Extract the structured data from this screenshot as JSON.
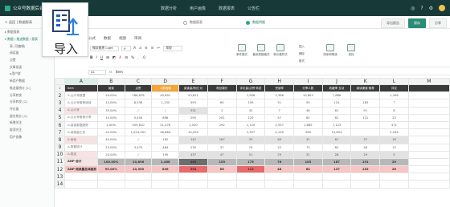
{
  "app": {
    "title": "公众号数据后台",
    "nav": [
      "数据分析",
      "用户画像",
      "数据报表",
      "公告栏"
    ]
  },
  "sidebar": {
    "header": "< 返回 | 数据报表",
    "items": [
      {
        "label": "▸ 数据报表",
        "indent": false,
        "active": false
      },
      {
        "label": "▾ 数据 / 推送数据 / 报表",
        "indent": false,
        "active": true
      },
      {
        "label": "表 (可编辑)",
        "indent": true,
        "active": false
      },
      {
        "label": "阅读量",
        "indent": true,
        "active": false
      },
      {
        "label": "点赞",
        "indent": true,
        "active": false
      },
      {
        "label": "文章阅读",
        "indent": true,
        "active": false
      },
      {
        "label": "a用户群",
        "indent": true,
        "active": false
      },
      {
        "label": "新用户数据",
        "indent": true,
        "active": false
      },
      {
        "label": "推送量统计 [1]",
        "indent": true,
        "active": false
      },
      {
        "label": "分享转发",
        "indent": true,
        "active": false
      },
      {
        "label": "分享转发 [2]",
        "indent": true,
        "active": false
      },
      {
        "label": "评论量",
        "indent": true,
        "active": false
      },
      {
        "label": "留言统计 [2]",
        "indent": true,
        "active": false
      },
      {
        "label": "新增关注",
        "indent": true,
        "active": false
      },
      {
        "label": "取消关注",
        "indent": true,
        "active": false
      },
      {
        "label": "用户画像",
        "indent": true,
        "active": false
      }
    ]
  },
  "import_button": {
    "label": "导入",
    "icon": "import-doc-icon"
  },
  "doc_tabs": [
    {
      "label": "数据报表",
      "active": false
    },
    {
      "label": "数据明细",
      "active": true
    }
  ],
  "strip_buttons": [
    "导出报告",
    "保存",
    "分享"
  ],
  "ribbon": {
    "tabs": [
      "公式",
      "数据",
      "视图",
      "审阅"
    ],
    "font": {
      "name": "微软雅黑 Light",
      "size": "9"
    },
    "fmt_label": "常规",
    "buttons": [
      "条件格式",
      "套用表格格式",
      "单元格样式",
      "插入",
      "删除",
      "格式",
      "排序和筛选",
      "查找"
    ]
  },
  "formula_bar": {
    "cell": "A1",
    "value": "Item"
  },
  "sheet": {
    "columns": [
      "A",
      "B",
      "C",
      "D",
      "E",
      "F",
      "G",
      "H",
      "I",
      "J",
      "K",
      "L",
      "M"
    ],
    "header_row": [
      "Item",
      "阅读",
      "点赞",
      "人群画像",
      "阅读量/粉丝·月",
      "粉丝增长",
      "评论量/点赞·转发",
      "完读率",
      "分享人数",
      "收藏率·互动",
      "阅读渠道·推荐",
      "评论"
    ],
    "rows": [
      [
        "A-公众号数据",
        "20.00%",
        "786,876",
        "40,691",
        "20,621",
        "",
        "1,908",
        "2,386",
        "10,803",
        "7,886",
        "",
        "1,396"
      ],
      [
        "A-公众号推荐阅读",
        "15.00%",
        "6,538",
        "1,130",
        "593",
        "60",
        "109",
        "51",
        "93",
        "124",
        "183",
        "7"
      ],
      [
        "A-公众号",
        "35.00%",
        "/",
        "/",
        "331",
        "2",
        "43",
        "7",
        "46",
        "61",
        "91",
        "8"
      ],
      [
        "A-公众号推荐分享",
        "15.00%",
        "5,404",
        "896",
        "295",
        "201",
        "120",
        "57",
        "62",
        "62",
        "121",
        "23"
      ],
      [
        "A-阅读数据趋势",
        "2.00%",
        "459,810",
        "21,476",
        "1,520",
        "292",
        "1,720",
        "2,557",
        "1,685",
        "7,123",
        "",
        "471"
      ],
      [
        "A-阅读量汇总",
        "20.00%",
        "1,024,901",
        "46,884",
        "10,092",
        "",
        "2,357",
        "4,150",
        "358",
        "10,854",
        "",
        "2,164"
      ],
      [
        "A-阅读",
        "40.00%",
        "/",
        "182",
        "142",
        "187",
        "33",
        "60",
        "42",
        "61",
        "37",
        "18"
      ],
      [
        "A-数据统计",
        "23.00%",
        "3,470",
        "484",
        "230",
        "37",
        "70",
        "22",
        "73",
        "82",
        "48",
        "13"
      ],
      [
        "A-推送",
        "20.00%",
        "/",
        "195",
        "437",
        "47",
        "51",
        "29",
        "31",
        "28",
        "29",
        "5"
      ],
      [
        "ANP-合计",
        "100.00%",
        "10,896",
        "1,468",
        "463",
        "155",
        "175",
        "76",
        "105",
        "187",
        "191",
        "20"
      ],
      [
        "ANP-阅读量总体趋势",
        "95.00%",
        "10,350",
        "836",
        "394",
        "86",
        "112",
        "48",
        "64",
        "137",
        "152",
        "26"
      ]
    ]
  },
  "colors": {
    "topbar": "#173a38",
    "accent": "#2fa88c",
    "header_orange": "#f3a43a",
    "header_dark": "#3a3a3a",
    "highlight_red": "#e86a6a"
  }
}
